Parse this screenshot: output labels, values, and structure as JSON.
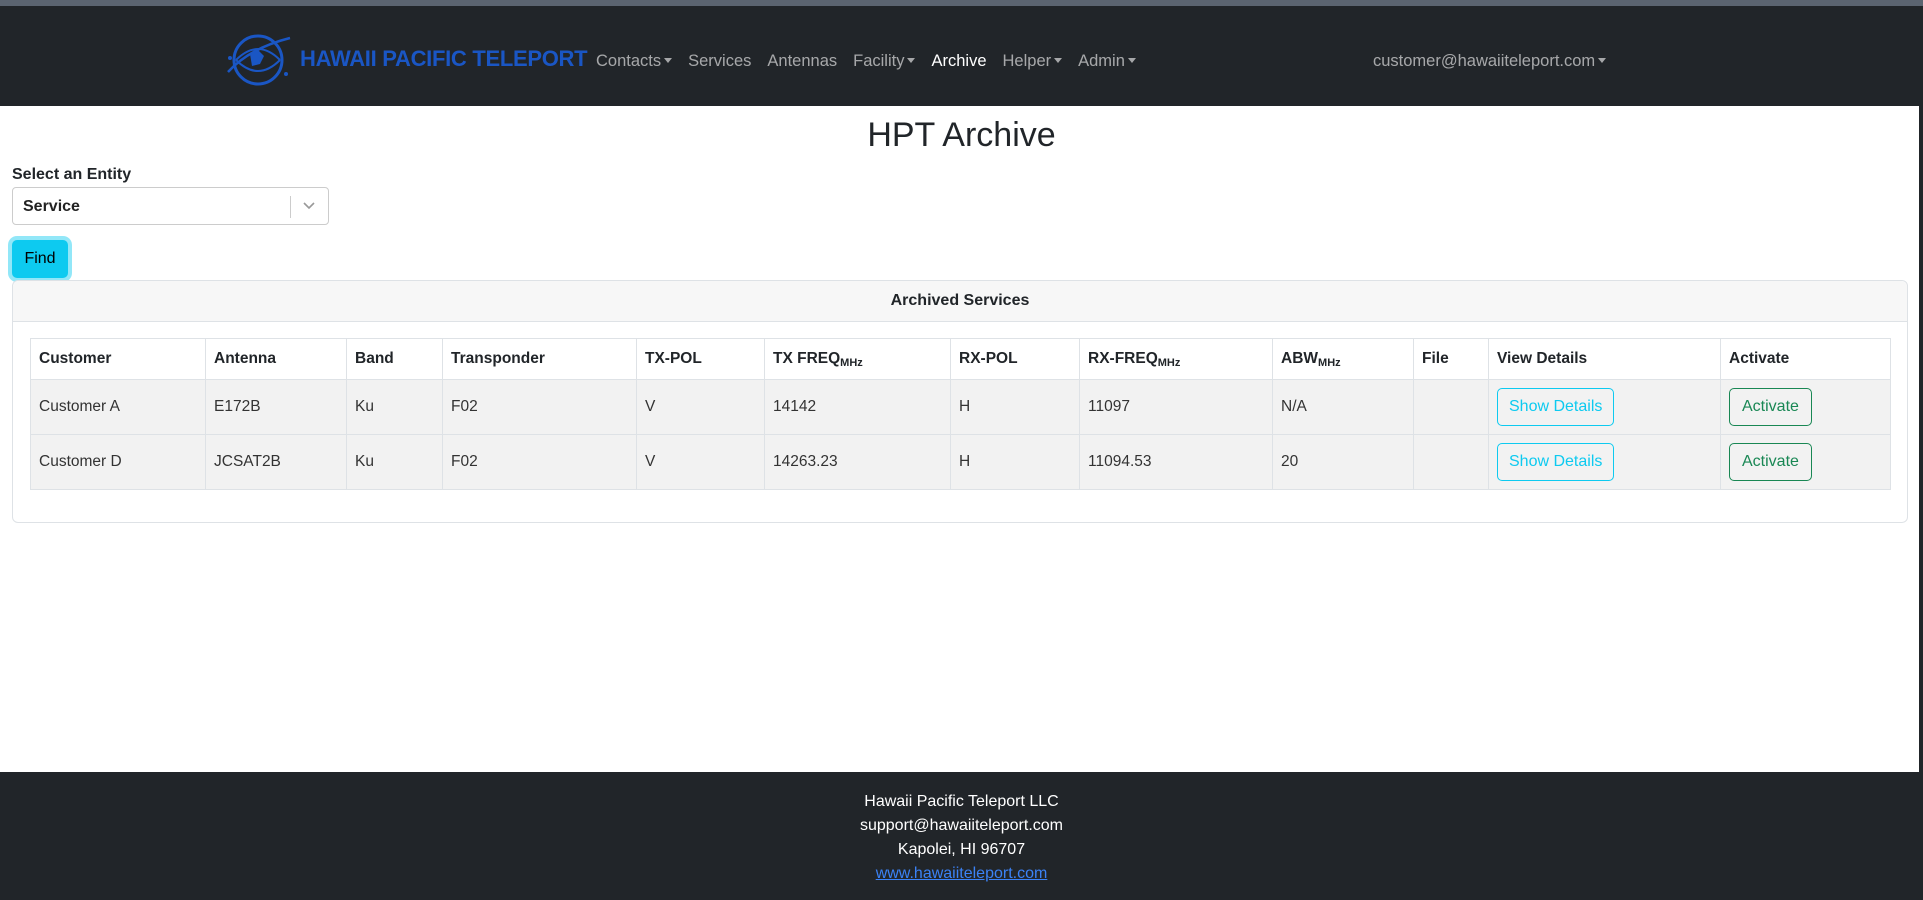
{
  "header": {
    "brand": "HAWAII PACIFIC TELEPORT",
    "nav": [
      {
        "label": "Contacts",
        "dropdown": true
      },
      {
        "label": "Services",
        "dropdown": false
      },
      {
        "label": "Antennas",
        "dropdown": false
      },
      {
        "label": "Facility",
        "dropdown": true
      },
      {
        "label": "Archive",
        "dropdown": false,
        "active": true
      },
      {
        "label": "Helper",
        "dropdown": true
      },
      {
        "label": "Admin",
        "dropdown": true
      }
    ],
    "user": "customer@hawaiiteleport.com"
  },
  "page": {
    "title": "HPT Archive",
    "entity_label": "Select an Entity",
    "entity_value": "Service",
    "find_label": "Find"
  },
  "card": {
    "title": "Archived Services",
    "columns": [
      {
        "label": "Customer",
        "sub": ""
      },
      {
        "label": "Antenna",
        "sub": ""
      },
      {
        "label": "Band",
        "sub": ""
      },
      {
        "label": "Transponder",
        "sub": ""
      },
      {
        "label": "TX-POL",
        "sub": ""
      },
      {
        "label": "TX FREQ",
        "sub": "MHz"
      },
      {
        "label": "RX-POL",
        "sub": ""
      },
      {
        "label": "RX-FREQ",
        "sub": "MHz"
      },
      {
        "label": "ABW",
        "sub": "MHz"
      },
      {
        "label": "File",
        "sub": ""
      },
      {
        "label": "View Details",
        "sub": ""
      },
      {
        "label": "Activate",
        "sub": ""
      }
    ],
    "rows": [
      {
        "customer": "Customer A",
        "antenna": "E172B",
        "band": "Ku",
        "transponder": "F02",
        "tx_pol": "V",
        "tx_freq": "14142",
        "rx_pol": "H",
        "rx_freq": "11097",
        "abw": "N/A",
        "file": "",
        "details_label": "Show Details",
        "activate_label": "Activate"
      },
      {
        "customer": "Customer D",
        "antenna": "JCSAT2B",
        "band": "Ku",
        "transponder": "F02",
        "tx_pol": "V",
        "tx_freq": "14263.23",
        "rx_pol": "H",
        "rx_freq": "11094.53",
        "abw": "20",
        "file": "",
        "details_label": "Show Details",
        "activate_label": "Activate"
      }
    ]
  },
  "footer": {
    "company": "Hawaii Pacific Teleport LLC",
    "email": "support@hawaiiteleport.com",
    "address": "Kapolei, HI 96707",
    "website": "www.hawaiiteleport.com"
  },
  "colors": {
    "navbar": "#212529",
    "brand": "#1a56c4",
    "info": "#0dcaf0",
    "success": "#198754"
  }
}
